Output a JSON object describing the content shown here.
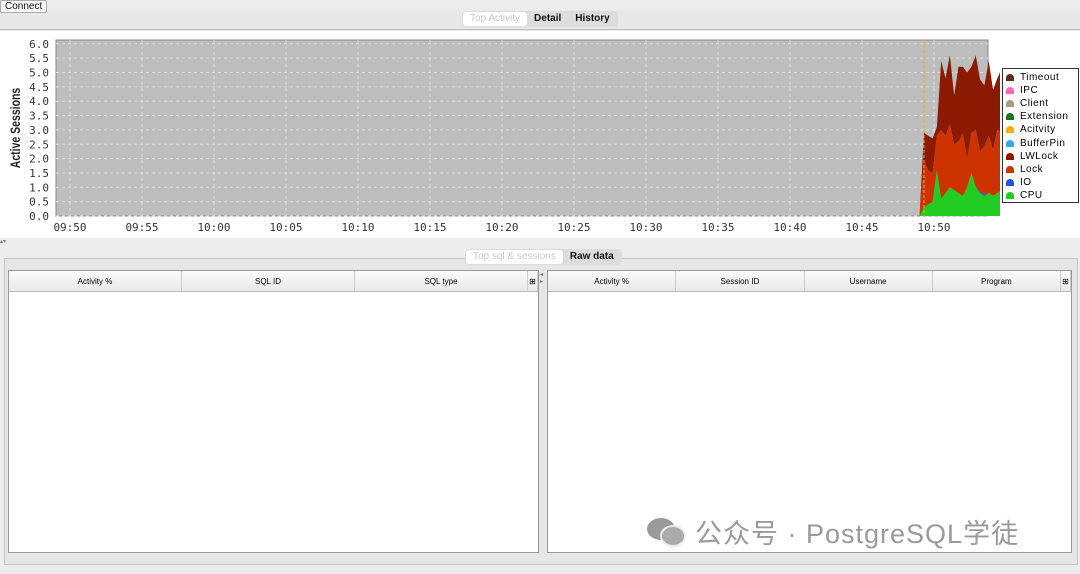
{
  "toolbar": {
    "connect_label": "Connect"
  },
  "top_tabs": [
    "Top Activity",
    "Detail",
    "History"
  ],
  "chart_data": {
    "type": "area",
    "ylabel": "Active Sessions",
    "ylim": [
      0,
      6.14
    ],
    "yticks": [
      "0.0",
      "0.5",
      "1.0",
      "1.5",
      "2.0",
      "2.5",
      "3.0",
      "3.5",
      "4.0",
      "4.5",
      "5.0",
      "5.5",
      "6.0"
    ],
    "xticks": [
      "09:50",
      "09:55",
      "10:00",
      "10:05",
      "10:10",
      "10:15",
      "10:20",
      "10:25",
      "10:30",
      "10:35",
      "10:40",
      "10:45",
      "10:50"
    ],
    "xrange_minutes_from_0950": [
      -0.98,
      64.75
    ],
    "marker_minutes_from_0950": 59.3,
    "x_minutes_from_0950": [
      59,
      59.3,
      59.6,
      59.9,
      60.2,
      60.5,
      60.8,
      61.1,
      61.4,
      61.7,
      62,
      62.3,
      62.6,
      62.9,
      63.2,
      63.5,
      63.8,
      64.1,
      64.4,
      64.75
    ],
    "series": [
      {
        "name": "CPU",
        "color": "#22cc22",
        "values": [
          0,
          0.3,
          0.4,
          0.5,
          1.6,
          0.6,
          0.8,
          1.0,
          0.9,
          0.8,
          0.7,
          1.0,
          1.5,
          1.0,
          0.8,
          0.7,
          0.8,
          0.7,
          0.8,
          0.9
        ]
      },
      {
        "name": "IO",
        "color": "#2255dd",
        "values": [
          0,
          0,
          0,
          0,
          0,
          0,
          0,
          0,
          0,
          0,
          0,
          0,
          0,
          0,
          0.05,
          0.05,
          0,
          0,
          0,
          0
        ]
      },
      {
        "name": "Lock",
        "color": "#cc3300",
        "values": [
          0,
          1.6,
          1.2,
          1.0,
          1.2,
          2.4,
          2.0,
          2.2,
          1.6,
          1.8,
          2.2,
          1.0,
          1.4,
          2.0,
          1.4,
          1.7,
          2.0,
          1.6,
          2.2,
          2.0
        ]
      },
      {
        "name": "LWLock",
        "color": "#8b1a00",
        "values": [
          0,
          1.0,
          1.2,
          1.2,
          0.3,
          2.4,
          2.0,
          2.4,
          1.7,
          2.6,
          2.3,
          3.0,
          2.3,
          2.6,
          2.5,
          2.1,
          2.6,
          2.1,
          1.8,
          2.3
        ]
      }
    ],
    "legend": [
      {
        "name": "Timeout",
        "color": "#5a3010"
      },
      {
        "name": "IPC",
        "color": "#ff66bb"
      },
      {
        "name": "Client",
        "color": "#a89a7a"
      },
      {
        "name": "Extension",
        "color": "#117722"
      },
      {
        "name": "Acitvity",
        "color": "#ffaa00"
      },
      {
        "name": "BufferPin",
        "color": "#33aaee"
      },
      {
        "name": "LWLock",
        "color": "#8b1a00"
      },
      {
        "name": "Lock",
        "color": "#cc3300"
      },
      {
        "name": "IO",
        "color": "#2255dd"
      },
      {
        "name": "CPU",
        "color": "#22cc22"
      }
    ]
  },
  "bottom_tabs": [
    "Top sql & sessions",
    "Raw data"
  ],
  "sql_table": {
    "columns": [
      "Activity %",
      "SQL ID",
      "SQL type"
    ]
  },
  "session_table": {
    "columns": [
      "Activity %",
      "Session ID",
      "Username",
      "Program"
    ]
  },
  "watermark": "公众号 · PostgreSQL学徒"
}
